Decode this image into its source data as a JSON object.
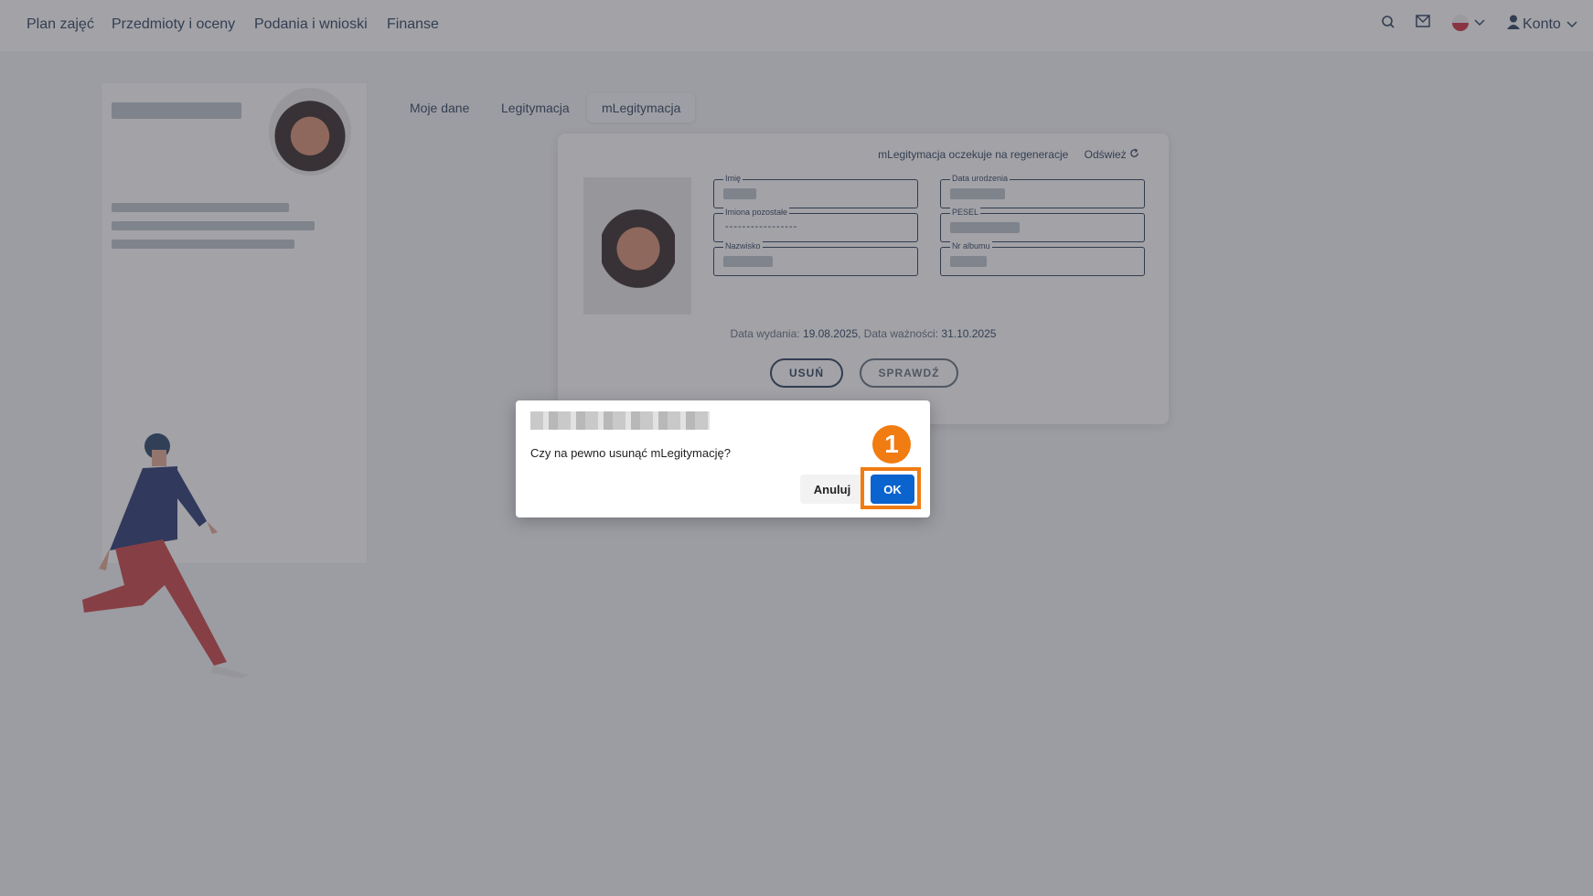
{
  "nav": {
    "items": [
      "Plan zajęć",
      "Przedmioty i oceny",
      "Podania i wnioski",
      "Finanse"
    ],
    "account_label": "Konto"
  },
  "tabs": [
    "Moje dane",
    "Legitymacja",
    "mLegitymacja"
  ],
  "card": {
    "status_text": "mLegitymacja oczekuje na regeneracje",
    "refresh_label": "Odśwież",
    "fields": {
      "first_name": {
        "label": "Imię"
      },
      "other_names": {
        "label": "Imiona pozostałe",
        "value": "-----------------"
      },
      "surname": {
        "label": "Nazwisko"
      },
      "birth_date": {
        "label": "Data urodzenia"
      },
      "pesel": {
        "label": "PESEL"
      },
      "album_no": {
        "label": "Nr albumu"
      }
    },
    "issue_label": "Data wydania:",
    "issue_date": "19.08.2025",
    "valid_label": "Data ważności:",
    "valid_date": "31.10.2025",
    "delete_label": "USUŃ",
    "check_label": "SPRAWDŹ"
  },
  "dialog": {
    "message": "Czy na pewno usunąć mLegitymację?",
    "cancel_label": "Anuluj",
    "ok_label": "OK"
  },
  "annotation": {
    "step": "1",
    "color": "#f07c12"
  },
  "colors": {
    "primary": "#0b63ce",
    "navy": "#1f3550",
    "accent": "#f07c12"
  }
}
